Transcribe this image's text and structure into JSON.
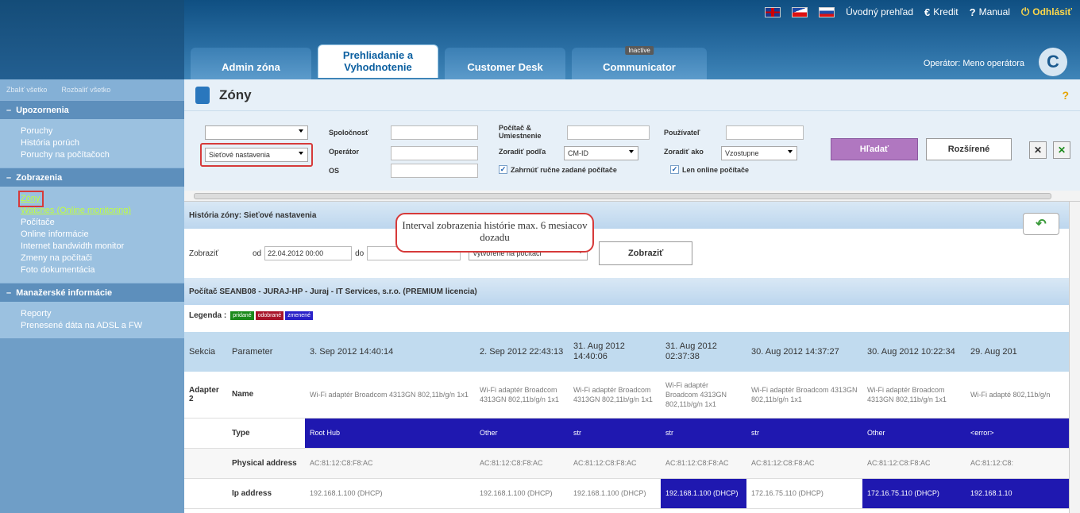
{
  "topbar": {
    "overview": "Úvodný prehľad",
    "credit": "Kredit",
    "manual": "Manual",
    "logout": "Odhlásiť"
  },
  "tabs": [
    {
      "label": "Admin zóna"
    },
    {
      "label": "Prehliadanie a Vyhodnotenie"
    },
    {
      "label": "Customer Desk"
    },
    {
      "label": "Communicator",
      "badge": "Inactive"
    }
  ],
  "operator": "Operátor: Meno operátora",
  "logo_letter": "C",
  "sidebar": {
    "collapse_all": "Zbaliť všetko",
    "expand_all": "Rozbaliť všetko",
    "groups": [
      {
        "title": "Upozornenia",
        "items": [
          "Poruchy",
          "História porúch",
          "Poruchy na počítačoch"
        ]
      },
      {
        "title": "Zobrazenia",
        "items": [
          "Zóny",
          "Watches (Online monitoring)",
          "Počítače",
          "Online informácie",
          "Internet bandwidth monitor",
          "Zmeny na počítači",
          "Foto dokumentácia"
        ]
      },
      {
        "title": "Manažerské informácie",
        "items": [
          "Reporty",
          "Prenesené dáta na ADSL a FW"
        ]
      }
    ]
  },
  "page": {
    "title": "Zóny",
    "help": "?"
  },
  "filters": {
    "select1": "",
    "select2": "Sieťové nastavenia",
    "company": "Spoločnosť",
    "operator": "Operátor",
    "os": "OS",
    "computer_loc": "Počítač & Umiestnenie",
    "sort_by": "Zoradiť podľa",
    "sort_by_value": "CM-ID",
    "user": "Používateľ",
    "sort_as": "Zoradiť ako",
    "sort_as_value": "Vzostupne",
    "search": "Hľadať",
    "advanced": "Rozšírené",
    "include_manual": "Zahrnúť ručne zadané počítače",
    "online_only": "Len online počítače"
  },
  "history": {
    "title": "História zóny: Sieťové nastavenia",
    "callout": "Interval zobrazenia histórie max. 6 mesiacov dozadu",
    "show_label": "Zobraziť",
    "from": "od",
    "from_value": "22.04.2012 00:00",
    "to": "do",
    "created": "Vytvorené na počítači",
    "show_button": "Zobraziť"
  },
  "computer": "Počítač SEANB08 - JURAJ-HP - Juraj - IT Services, s.r.o. (PREMIUM licencia)",
  "legend": {
    "label": "Legenda :",
    "added": "pridané",
    "removed": "odobrané",
    "changed": "zmenené",
    "colors": {
      "added": "#1b8a1b",
      "removed": "#a8142a",
      "changed": "#2a22c8"
    }
  },
  "grid": {
    "headers": [
      "Sekcia",
      "Parameter",
      "3. Sep 2012 14:40:14",
      "2. Sep 2012 22:43:13",
      "31. Aug 2012 14:40:06",
      "31. Aug 2012 02:37:38",
      "30. Aug 2012 14:37:27",
      "30. Aug 2012 10:22:34",
      "29. Aug 201"
    ],
    "section": "Adapter 2",
    "rows": [
      {
        "param": "Name",
        "values": [
          "Wi-Fi adaptér Broadcom 4313GN 802,11b/g/n 1x1",
          "Wi-Fi adaptér Broadcom 4313GN 802,11b/g/n 1x1",
          "Wi-Fi adaptér Broadcom 4313GN 802,11b/g/n 1x1",
          "Wi-Fi adaptér Broadcom 4313GN 802,11b/g/n 1x1",
          "Wi-Fi adaptér Broadcom 4313GN 802,11b/g/n 1x1",
          "Wi-Fi adaptér Broadcom 4313GN 802,11b/g/n 1x1",
          "Wi-Fi adapté 802,11b/g/n"
        ]
      },
      {
        "param": "Type",
        "values": [
          "Root Hub",
          "Other",
          "str",
          "str",
          "str",
          "Other",
          "<error>"
        ]
      },
      {
        "param": "Physical address",
        "values": [
          "AC:81:12:C8:F8:AC",
          "AC:81:12:C8:F8:AC",
          "AC:81:12:C8:F8:AC",
          "AC:81:12:C8:F8:AC",
          "AC:81:12:C8:F8:AC",
          "AC:81:12:C8:F8:AC",
          "AC:81:12:C8:"
        ]
      },
      {
        "param": "Ip address",
        "values": [
          "192.168.1.100 (DHCP)",
          "192.168.1.100 (DHCP)",
          "192.168.1.100 (DHCP)",
          "192.168.1.100 (DHCP)",
          "172.16.75.110 (DHCP)",
          "172.16.75.110 (DHCP)",
          "192.168.1.10"
        ]
      }
    ]
  }
}
